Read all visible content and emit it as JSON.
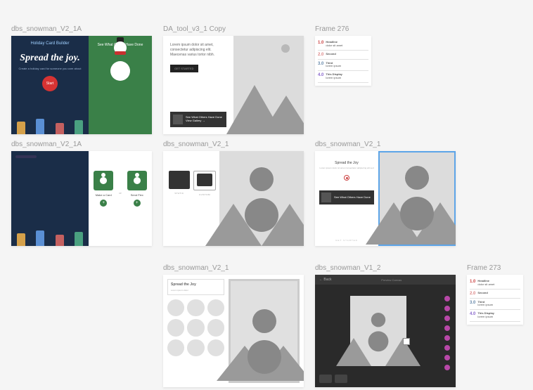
{
  "frames": {
    "r1c1": {
      "label": "dbs_snowman_V2_1A"
    },
    "r1c2": {
      "label": "DA_tool_v3_1 Copy"
    },
    "r1c3": {
      "label": "Frame 276"
    },
    "r2c1": {
      "label": "dbs_snowman_V2_1A"
    },
    "r2c2": {
      "label": "dbs_snowman_V2_1"
    },
    "r2c3": {
      "label": "dbs_snowman_V2_1"
    },
    "r3c1": {
      "label": "dbs_snowman_V2_1"
    },
    "r3c2": {
      "label": "dbs_snowman_V1_2"
    },
    "r3c3": {
      "label": "Frame 273"
    }
  },
  "card1": {
    "banner": "Holiday Card Builder",
    "title": "Spread the joy.",
    "subtitle": "Create a holiday card for someone you care about",
    "button": "Start",
    "rightLabel": "See What Others Have Done"
  },
  "card2": {
    "lorem": "Lorem ipsum dolor sit amet, consectetur adipiscing elit. Maecenas varius tortor nibh.",
    "button": "GET STARTED",
    "calloutTitle": "See What Others Have Done",
    "calloutSub": "View Gallery →"
  },
  "steps": [
    {
      "num": "1.0",
      "cls": "red",
      "title": "Headline",
      "sub": "dolor sit amet"
    },
    {
      "num": "2.0",
      "cls": "orange",
      "title": "Second",
      "sub": ""
    },
    {
      "num": "3.0",
      "cls": "blue",
      "title": "Third",
      "sub": "lorem ipsum"
    },
    {
      "num": "4.0",
      "cls": "purple",
      "title": "This Display",
      "sub": "lorem ipsum"
    }
  ],
  "card3": {
    "choice1": "Make a Card",
    "or": "or",
    "choice2": "Send Flex"
  },
  "card4": {
    "opt1": "STATIC",
    "opt2": "CUSTOM"
  },
  "card5": {
    "title": "Spread the Joy",
    "subtitle": "Lorem ipsum dolor sit amet consectetur adipiscing elit sed",
    "calloutTitle": "See What Others Have Done",
    "footer": "GET STARTED"
  },
  "card6": {
    "headerTitle": "Spread the Joy",
    "headerSub": "Lorem ipsum dolor"
  },
  "card7": {
    "back": "← Back",
    "centerLabel": "Preview Canvas"
  }
}
